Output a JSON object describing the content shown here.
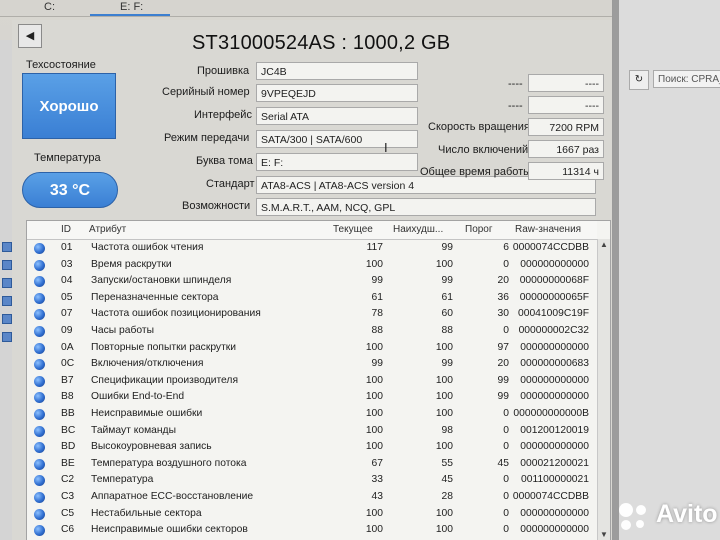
{
  "drive_tabs": [
    {
      "label": "C:",
      "active": false
    },
    {
      "label": "E: F:",
      "active": true
    }
  ],
  "back_icon": "back-arrow-icon",
  "drive_title": "ST31000524AS : 1000,2 GB",
  "health": {
    "label": "Техсостояние",
    "value": "Хорошо",
    "color": "#3a7fd4"
  },
  "temperature": {
    "label": "Температура",
    "value": "33 °C"
  },
  "info": {
    "firmware": {
      "label": "Прошивка",
      "value": "JC4B"
    },
    "serial": {
      "label": "Серийный номер",
      "value": "9VPEQEJD"
    },
    "interface": {
      "label": "Интерфейс",
      "value": "Serial ATA"
    },
    "transfer_mode": {
      "label": "Режим передачи",
      "value": "SATA/300 | SATA/600"
    },
    "drive_letter": {
      "label": "Буква тома",
      "value": "E: F:"
    },
    "standard": {
      "label": "Стандарт",
      "value": "ATA8-ACS | ATA8-ACS version 4"
    },
    "features": {
      "label": "Возможности",
      "value": "S.M.A.R.T., AAM, NCQ, GPL"
    }
  },
  "right_info": {
    "blank1": {
      "label": "----",
      "value": "----"
    },
    "blank2": {
      "label": "----",
      "value": "----"
    },
    "rotation": {
      "label": "Скорость вращения",
      "value": "7200 RPM"
    },
    "power_count": {
      "label": "Число включений",
      "value": "1667 раз"
    },
    "power_hours": {
      "label": "Общее время работы",
      "value": "11314 ч"
    }
  },
  "smart_table": {
    "headers": {
      "id": "ID",
      "attr": "Атрибут",
      "current": "Текущее",
      "worst": "Наихудш...",
      "threshold": "Порог",
      "raw": "Raw-значения"
    },
    "rows": [
      {
        "id": "01",
        "name": "Частота ошибок чтения",
        "current": "117",
        "worst": "99",
        "threshold": "6",
        "raw": "0000074CCDBB"
      },
      {
        "id": "03",
        "name": "Время раскрутки",
        "current": "100",
        "worst": "100",
        "threshold": "0",
        "raw": "000000000000"
      },
      {
        "id": "04",
        "name": "Запуски/остановки шпинделя",
        "current": "99",
        "worst": "99",
        "threshold": "20",
        "raw": "00000000068F"
      },
      {
        "id": "05",
        "name": "Переназначенные сектора",
        "current": "61",
        "worst": "61",
        "threshold": "36",
        "raw": "00000000065F"
      },
      {
        "id": "07",
        "name": "Частота ошибок позиционирования",
        "current": "78",
        "worst": "60",
        "threshold": "30",
        "raw": "00041009C19F"
      },
      {
        "id": "09",
        "name": "Часы работы",
        "current": "88",
        "worst": "88",
        "threshold": "0",
        "raw": "000000002C32"
      },
      {
        "id": "0A",
        "name": "Повторные попытки раскрутки",
        "current": "100",
        "worst": "100",
        "threshold": "97",
        "raw": "000000000000"
      },
      {
        "id": "0C",
        "name": "Включения/отключения",
        "current": "99",
        "worst": "99",
        "threshold": "20",
        "raw": "000000000683"
      },
      {
        "id": "B7",
        "name": "Спецификации производителя",
        "current": "100",
        "worst": "100",
        "threshold": "99",
        "raw": "000000000000"
      },
      {
        "id": "B8",
        "name": "Ошибки End-to-End",
        "current": "100",
        "worst": "100",
        "threshold": "99",
        "raw": "000000000000"
      },
      {
        "id": "BB",
        "name": "Неисправимые ошибки",
        "current": "100",
        "worst": "100",
        "threshold": "0",
        "raw": "000000000000B"
      },
      {
        "id": "BC",
        "name": "Таймаут команды",
        "current": "100",
        "worst": "98",
        "threshold": "0",
        "raw": "001200120019"
      },
      {
        "id": "BD",
        "name": "Высокоуровневая запись",
        "current": "100",
        "worst": "100",
        "threshold": "0",
        "raw": "000000000000"
      },
      {
        "id": "BE",
        "name": "Температура воздушного потока",
        "current": "67",
        "worst": "55",
        "threshold": "45",
        "raw": "000021200021"
      },
      {
        "id": "C2",
        "name": "Температура",
        "current": "33",
        "worst": "45",
        "threshold": "0",
        "raw": "001100000021"
      },
      {
        "id": "C3",
        "name": "Аппаратное ECC-восстановление",
        "current": "43",
        "worst": "28",
        "threshold": "0",
        "raw": "0000074CCDBB"
      },
      {
        "id": "C5",
        "name": "Нестабильные сектора",
        "current": "100",
        "worst": "100",
        "threshold": "0",
        "raw": "000000000000"
      },
      {
        "id": "C6",
        "name": "Неисправимые ошибки секторов",
        "current": "100",
        "worst": "100",
        "threshold": "0",
        "raw": "000000000000"
      }
    ]
  },
  "background_window": {
    "address_text": "Поиск: CPRA_Y"
  },
  "watermark": "Avito"
}
